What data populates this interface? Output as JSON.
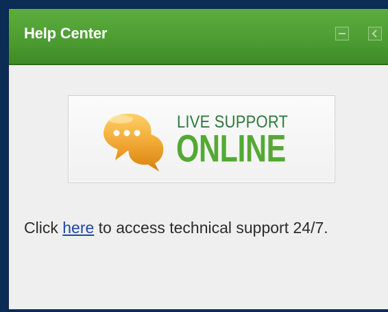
{
  "panel": {
    "title": "Help Center",
    "buttons": [
      {
        "name": "minimize-button",
        "icon": "minimize-icon"
      },
      {
        "name": "collapse-button",
        "icon": "chevron-left-icon"
      }
    ]
  },
  "banner": {
    "top_text": "LIVE SUPPORT",
    "main_text": "ONLINE",
    "icon": "chat-bubbles-icon"
  },
  "message": {
    "prefix": "Click ",
    "link_text": "here",
    "suffix": " to access technical support 24/7."
  },
  "colors": {
    "header_green": "#4d9d33",
    "online_green": "#54a934",
    "live_support_green": "#2c7a3c",
    "bubble_orange": "#f2a81f",
    "link_blue": "#1f47a3",
    "frame_navy": "#0b2c55"
  }
}
